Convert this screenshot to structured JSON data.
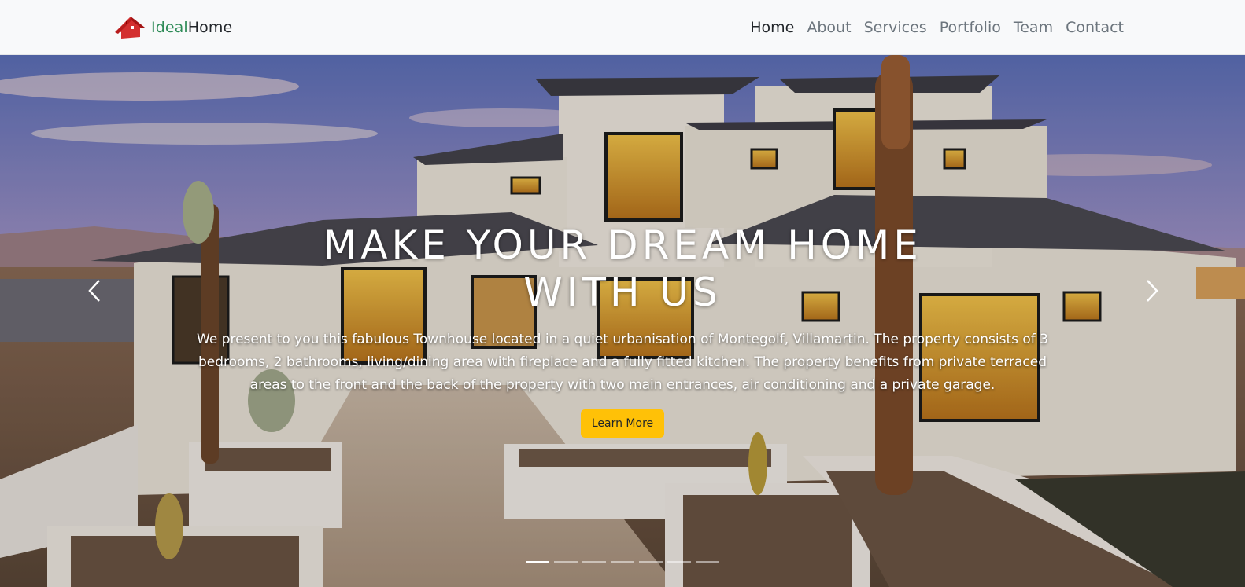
{
  "brand": {
    "part1": "Ideal",
    "part2": "Home",
    "logo_icon": "house-icon",
    "colors": {
      "ideal": "#2e8b57",
      "roof": "#d32f2f"
    }
  },
  "nav": {
    "items": [
      {
        "label": "Home",
        "active": true
      },
      {
        "label": "About",
        "active": false
      },
      {
        "label": "Services",
        "active": false
      },
      {
        "label": "Portfolio",
        "active": false
      },
      {
        "label": "Team",
        "active": false
      },
      {
        "label": "Contact",
        "active": false
      }
    ]
  },
  "hero": {
    "title": "MAKE YOUR DREAM HOME WITH US",
    "description": "We present to you this fabulous Townhouse located in a quiet urbanisation of Montegolf, Villamartin. The property consists of 3 bedrooms, 2 bathrooms, living/dining area with fireplace and a fully fitted kitchen. The property benefits from private terraced areas to the front and the back of the property with two main entrances, air conditioning and a private garage.",
    "button_label": "Learn More",
    "button_color": "#ffc107",
    "prev_icon": "chevron-left-icon",
    "next_icon": "chevron-right-icon",
    "slide_count": 7,
    "active_slide": 1
  }
}
